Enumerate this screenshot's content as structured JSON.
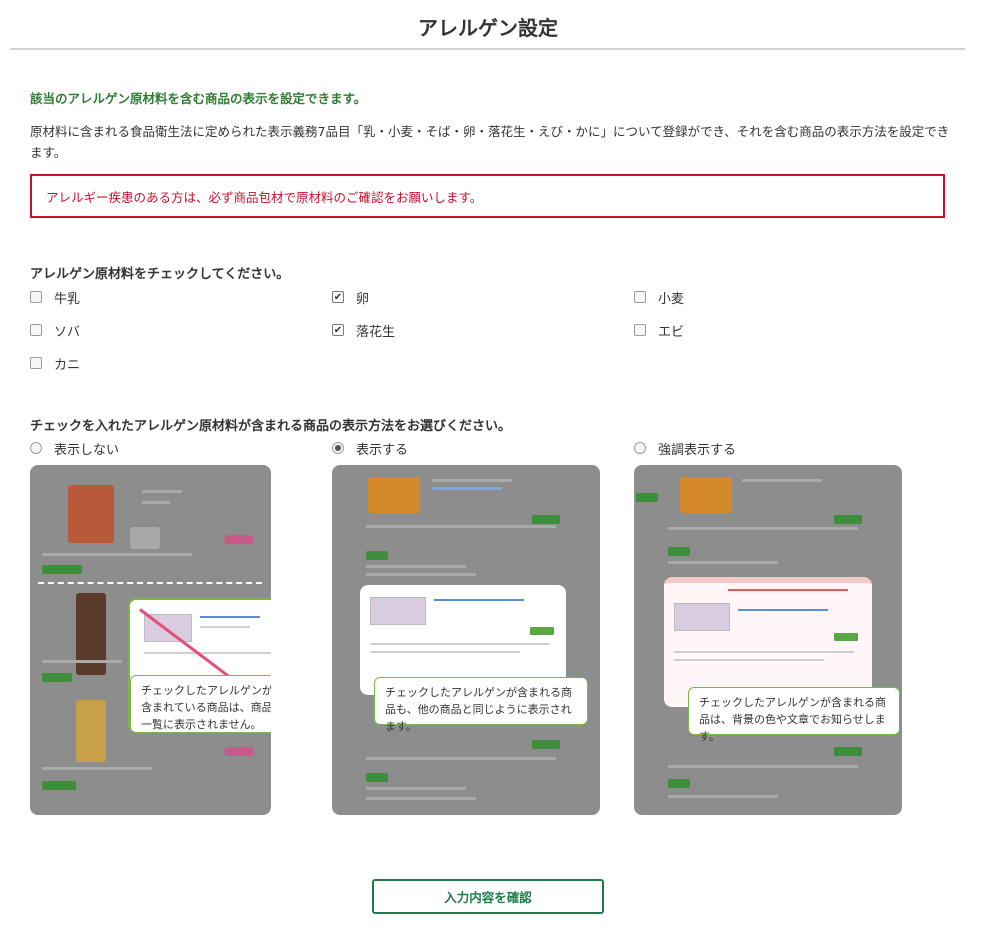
{
  "header": {
    "title": "アレルゲン設定"
  },
  "intro": {
    "lead": "該当のアレルゲン原材料を含む商品の表示を設定できます。",
    "description": "原材料に含まれる食品衛生法に定められた表示義務7品目「乳・小麦・そば・卵・落花生・えび・かに」について登録ができ、それを含む商品の表示方法を設定できます。",
    "warning": "アレルギー疾患のある方は、必ず商品包材で原材料のご確認をお願いします。"
  },
  "allergens": {
    "heading": "アレルゲン原材料をチェックしてください。",
    "items": [
      {
        "label": "牛乳",
        "checked": false
      },
      {
        "label": "卵",
        "checked": true
      },
      {
        "label": "小麦",
        "checked": false
      },
      {
        "label": "ソバ",
        "checked": false
      },
      {
        "label": "落花生",
        "checked": true
      },
      {
        "label": "エビ",
        "checked": false
      },
      {
        "label": "カニ",
        "checked": false
      }
    ]
  },
  "display": {
    "heading": "チェックを入れたアレルゲン原材料が含まれる商品の表示方法をお選びください。",
    "options": [
      {
        "label": "表示しない",
        "selected": false,
        "caption": "チェックしたアレルゲンが含まれている商品は、商品一覧に表示されません。"
      },
      {
        "label": "表示する",
        "selected": true,
        "caption": "チェックしたアレルゲンが含まれる商品も、他の商品と同じように表示されます。"
      },
      {
        "label": "強調表示する",
        "selected": false,
        "caption": "チェックしたアレルゲンが含まれる商品は、背景の色や文章でお知らせします。"
      }
    ]
  },
  "footer": {
    "confirm_label": "入力内容を確認"
  },
  "colors": {
    "accent_green": "#2e7d32",
    "warning_red": "#c8102e",
    "button_border": "#1f7a4a",
    "bubble_border": "#7ab648"
  }
}
